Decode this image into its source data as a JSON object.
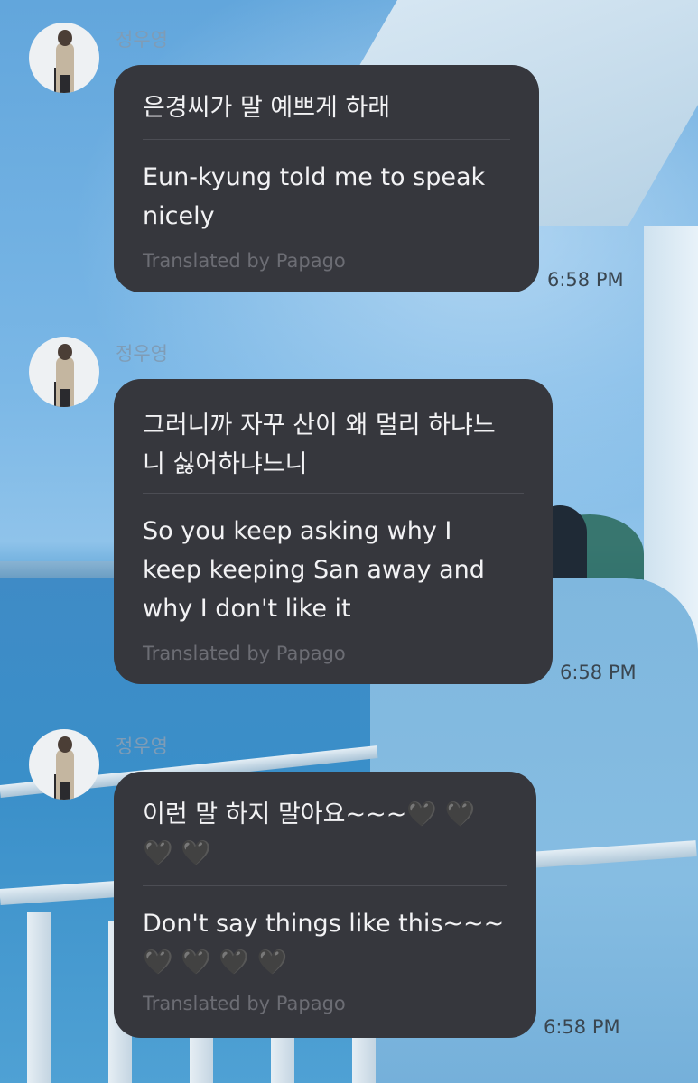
{
  "messages": [
    {
      "sender": "정우영",
      "original": "은경씨가 말 예쁘게 하래",
      "translation": "Eun-kyung told me to speak\nnicely",
      "credit": "Translated by Papago",
      "time": "6:58 PM"
    },
    {
      "sender": "정우영",
      "original": "그러니까 자꾸 산이 왜 멀리 하냐느\n니 싫어하냐느니",
      "translation": "So you keep asking why I\nkeep keeping San away and\nwhy I don't like it",
      "credit": "Translated by Papago",
      "time": "6:58 PM"
    },
    {
      "sender": "정우영",
      "original": "이런 말 하지 말아요~~~🖤 🖤\n🖤 🖤",
      "translation": "Don't say things like this~~~\n🖤 🖤 🖤 🖤",
      "credit": "Translated by Papago",
      "time": "6:58 PM"
    }
  ],
  "colors": {
    "bubble": "#36373d",
    "bubble_text": "#f2f2f4",
    "credit_text": "#6c6d74",
    "sender_text": "#7f9cb6"
  },
  "icons": {
    "avatar": "profile-photo"
  }
}
